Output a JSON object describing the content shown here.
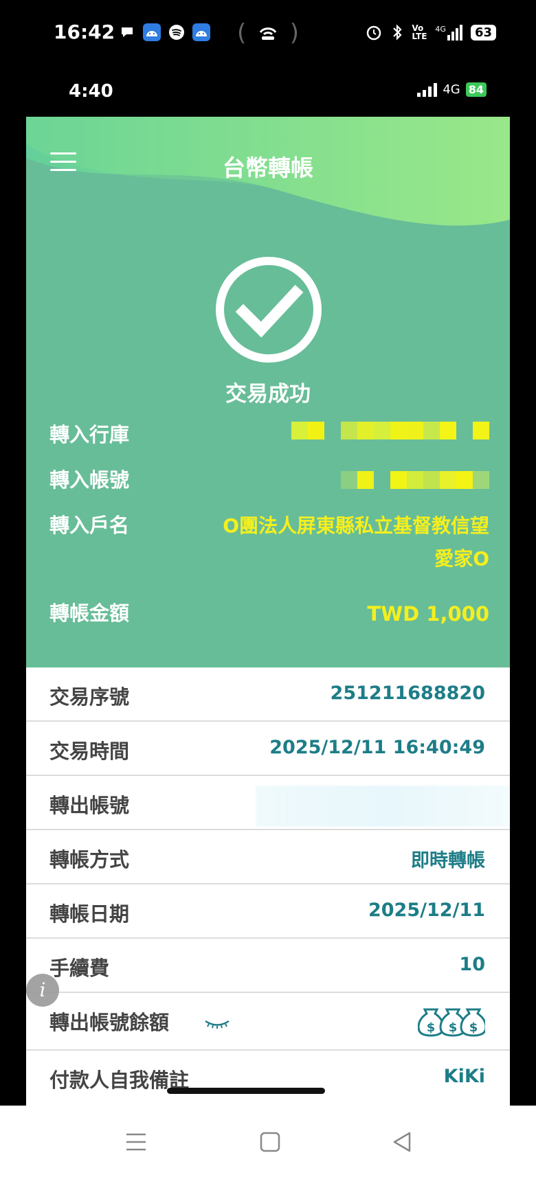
{
  "outer_status": {
    "time": "16:42",
    "battery": "63",
    "network": "4G"
  },
  "inner_status": {
    "time": "4:40",
    "network": "4G",
    "battery": "84"
  },
  "header": {
    "title": "台幣轉帳"
  },
  "result": {
    "status_text": "交易成功"
  },
  "transfer_info": {
    "bank_label": "轉入行庫",
    "account_label": "轉入帳號",
    "name_label": "轉入戶名",
    "name_value_line1": "O團法人屏東縣私立基督教信望",
    "name_value_line2": "愛家O",
    "amount_label": "轉帳金額",
    "amount_value": "TWD 1,000"
  },
  "details": {
    "rows": [
      {
        "label": "交易序號",
        "value": "251211688820"
      },
      {
        "label": "交易時間",
        "value": "2025/12/11 16:40:49"
      },
      {
        "label": "轉出帳號",
        "value": ""
      },
      {
        "label": "轉帳方式",
        "value": "即時轉帳"
      },
      {
        "label": "轉帳日期",
        "value": "2025/12/11"
      },
      {
        "label": "手續費",
        "value": "10"
      },
      {
        "label": "轉出帳號餘額",
        "value": ""
      },
      {
        "label": "付款人自我備註",
        "value": "KiKi"
      }
    ]
  },
  "icons": {
    "menu": "hamburger-icon",
    "success": "check-circle-icon",
    "eye": "eye-closed-icon",
    "balance": "money-bags-icon",
    "info": "info-icon"
  },
  "colors": {
    "hero_bg": "#67bd98",
    "highlight_text": "#f5ef1e",
    "detail_value": "#1d7d87"
  }
}
